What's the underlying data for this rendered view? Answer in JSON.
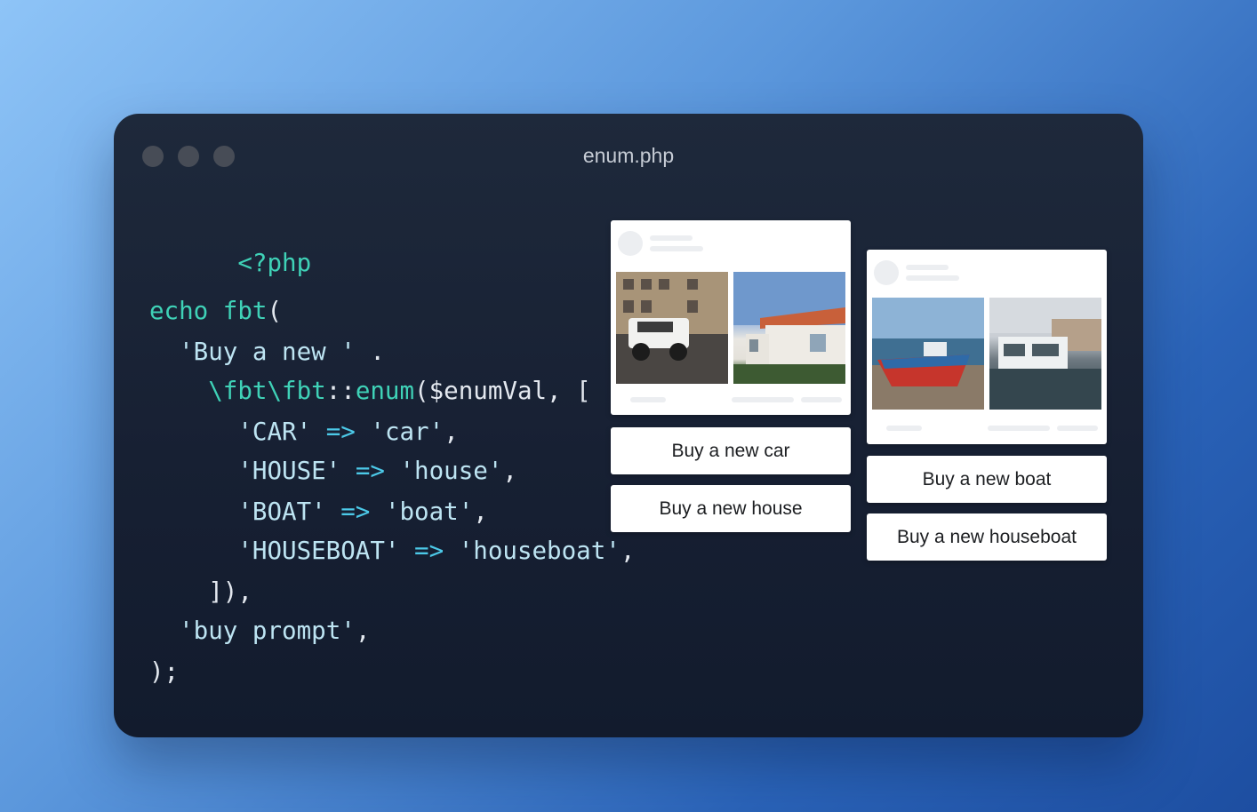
{
  "window": {
    "title": "enum.php",
    "controls": [
      "close",
      "minimize",
      "maximize"
    ]
  },
  "code": {
    "line1": {
      "kw": "<?php"
    },
    "line2": {
      "kw_echo": "echo",
      "kw_fbt": "fbt",
      "paren": "("
    },
    "line3": {
      "str": "'Buy a new '",
      "op": " ."
    },
    "line4": {
      "ns": "\\fbt\\fbt",
      "sep": "::",
      "fn": "enum",
      "args": "($enumVal, ["
    },
    "line5": {
      "key": "'CAR'",
      "arrow": "=>",
      "val": "'car'",
      "comma": ","
    },
    "line6": {
      "key": "'HOUSE'",
      "arrow": "=>",
      "val": "'house'",
      "comma": ","
    },
    "line7": {
      "key": "'BOAT'",
      "arrow": "=>",
      "val": "'boat'",
      "comma": ","
    },
    "line8": {
      "key": "'HOUSEBOAT'",
      "arrow": "=>",
      "val": "'houseboat'",
      "comma": ","
    },
    "line9": {
      "text": "]),"
    },
    "line10": {
      "str": "'buy prompt'",
      "comma": ","
    },
    "line11": {
      "text": ");"
    }
  },
  "buttons": {
    "car": "Buy a new car",
    "house": "Buy a new house",
    "boat": "Buy a new boat",
    "houseboat": "Buy a new houseboat"
  },
  "colors": {
    "keyword": "#3fd2b7",
    "operator": "#4cc9e8",
    "string": "#bde4f2",
    "plain": "#e3e8ef",
    "window_bg": "#1e293b"
  }
}
